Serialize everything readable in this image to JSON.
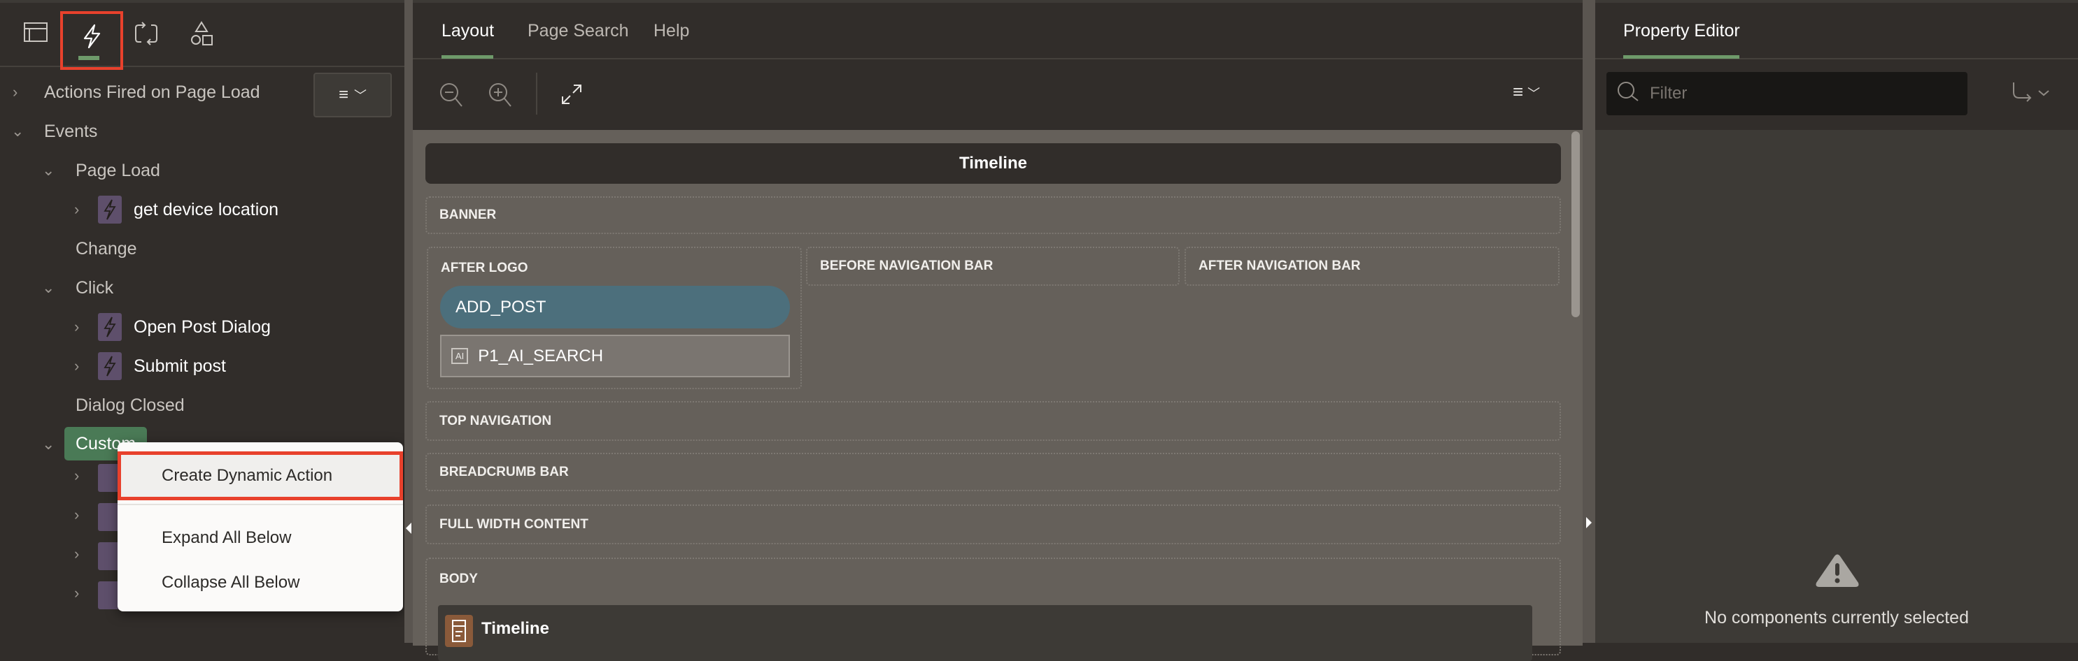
{
  "left_panel": {
    "tabs": [
      {
        "icon": "rendering-icon"
      },
      {
        "icon": "dynamic-actions-icon",
        "active": true
      },
      {
        "icon": "processing-icon"
      },
      {
        "icon": "shared-components-icon"
      }
    ],
    "tree": [
      {
        "label": "Actions Fired on Page Load",
        "level": 1,
        "state": "collapsed"
      },
      {
        "label": "Events",
        "level": 1,
        "state": "expanded"
      },
      {
        "label": "Page Load",
        "level": 2,
        "state": "expanded"
      },
      {
        "label": "get device location",
        "level": 3,
        "state": "collapsed"
      },
      {
        "label": "Change",
        "level": 2
      },
      {
        "label": "Click",
        "level": 2,
        "state": "expanded"
      },
      {
        "label": "Open Post Dialog",
        "level": 3,
        "state": "collapsed"
      },
      {
        "label": "Submit post",
        "level": 3,
        "state": "collapsed"
      },
      {
        "label": "Dialog Closed",
        "level": 2
      },
      {
        "label": "Custom",
        "level": 2,
        "state": "expanded",
        "selected": true
      }
    ],
    "context_menu": {
      "items": [
        "Create Dynamic Action",
        "Expand All Below",
        "Collapse All Below"
      ],
      "highlighted": "Create Dynamic Action"
    }
  },
  "middle": {
    "tabs": [
      "Layout",
      "Page Search",
      "Help"
    ],
    "active_tab": "Layout",
    "page_title": "Timeline",
    "regions": {
      "banner": "BANNER",
      "after_logo": "AFTER LOGO",
      "before_nav": "BEFORE NAVIGATION BAR",
      "after_nav": "AFTER NAVIGATION BAR",
      "top_nav": "TOP NAVIGATION",
      "breadcrumb": "BREADCRUMB BAR",
      "full_width": "FULL WIDTH CONTENT",
      "body": "BODY"
    },
    "button_add_post": "ADD_POST",
    "item_search": "P1_AI_SEARCH",
    "item_search_icon": "AI",
    "body_region": "Timeline"
  },
  "right": {
    "tab": "Property Editor",
    "filter_placeholder": "Filter",
    "empty_message": "No components currently selected"
  },
  "colors": {
    "accent": "#6e9a6a",
    "highlight": "#e8412c",
    "button": "#4c6f7c",
    "selected": "#4a7a56"
  }
}
